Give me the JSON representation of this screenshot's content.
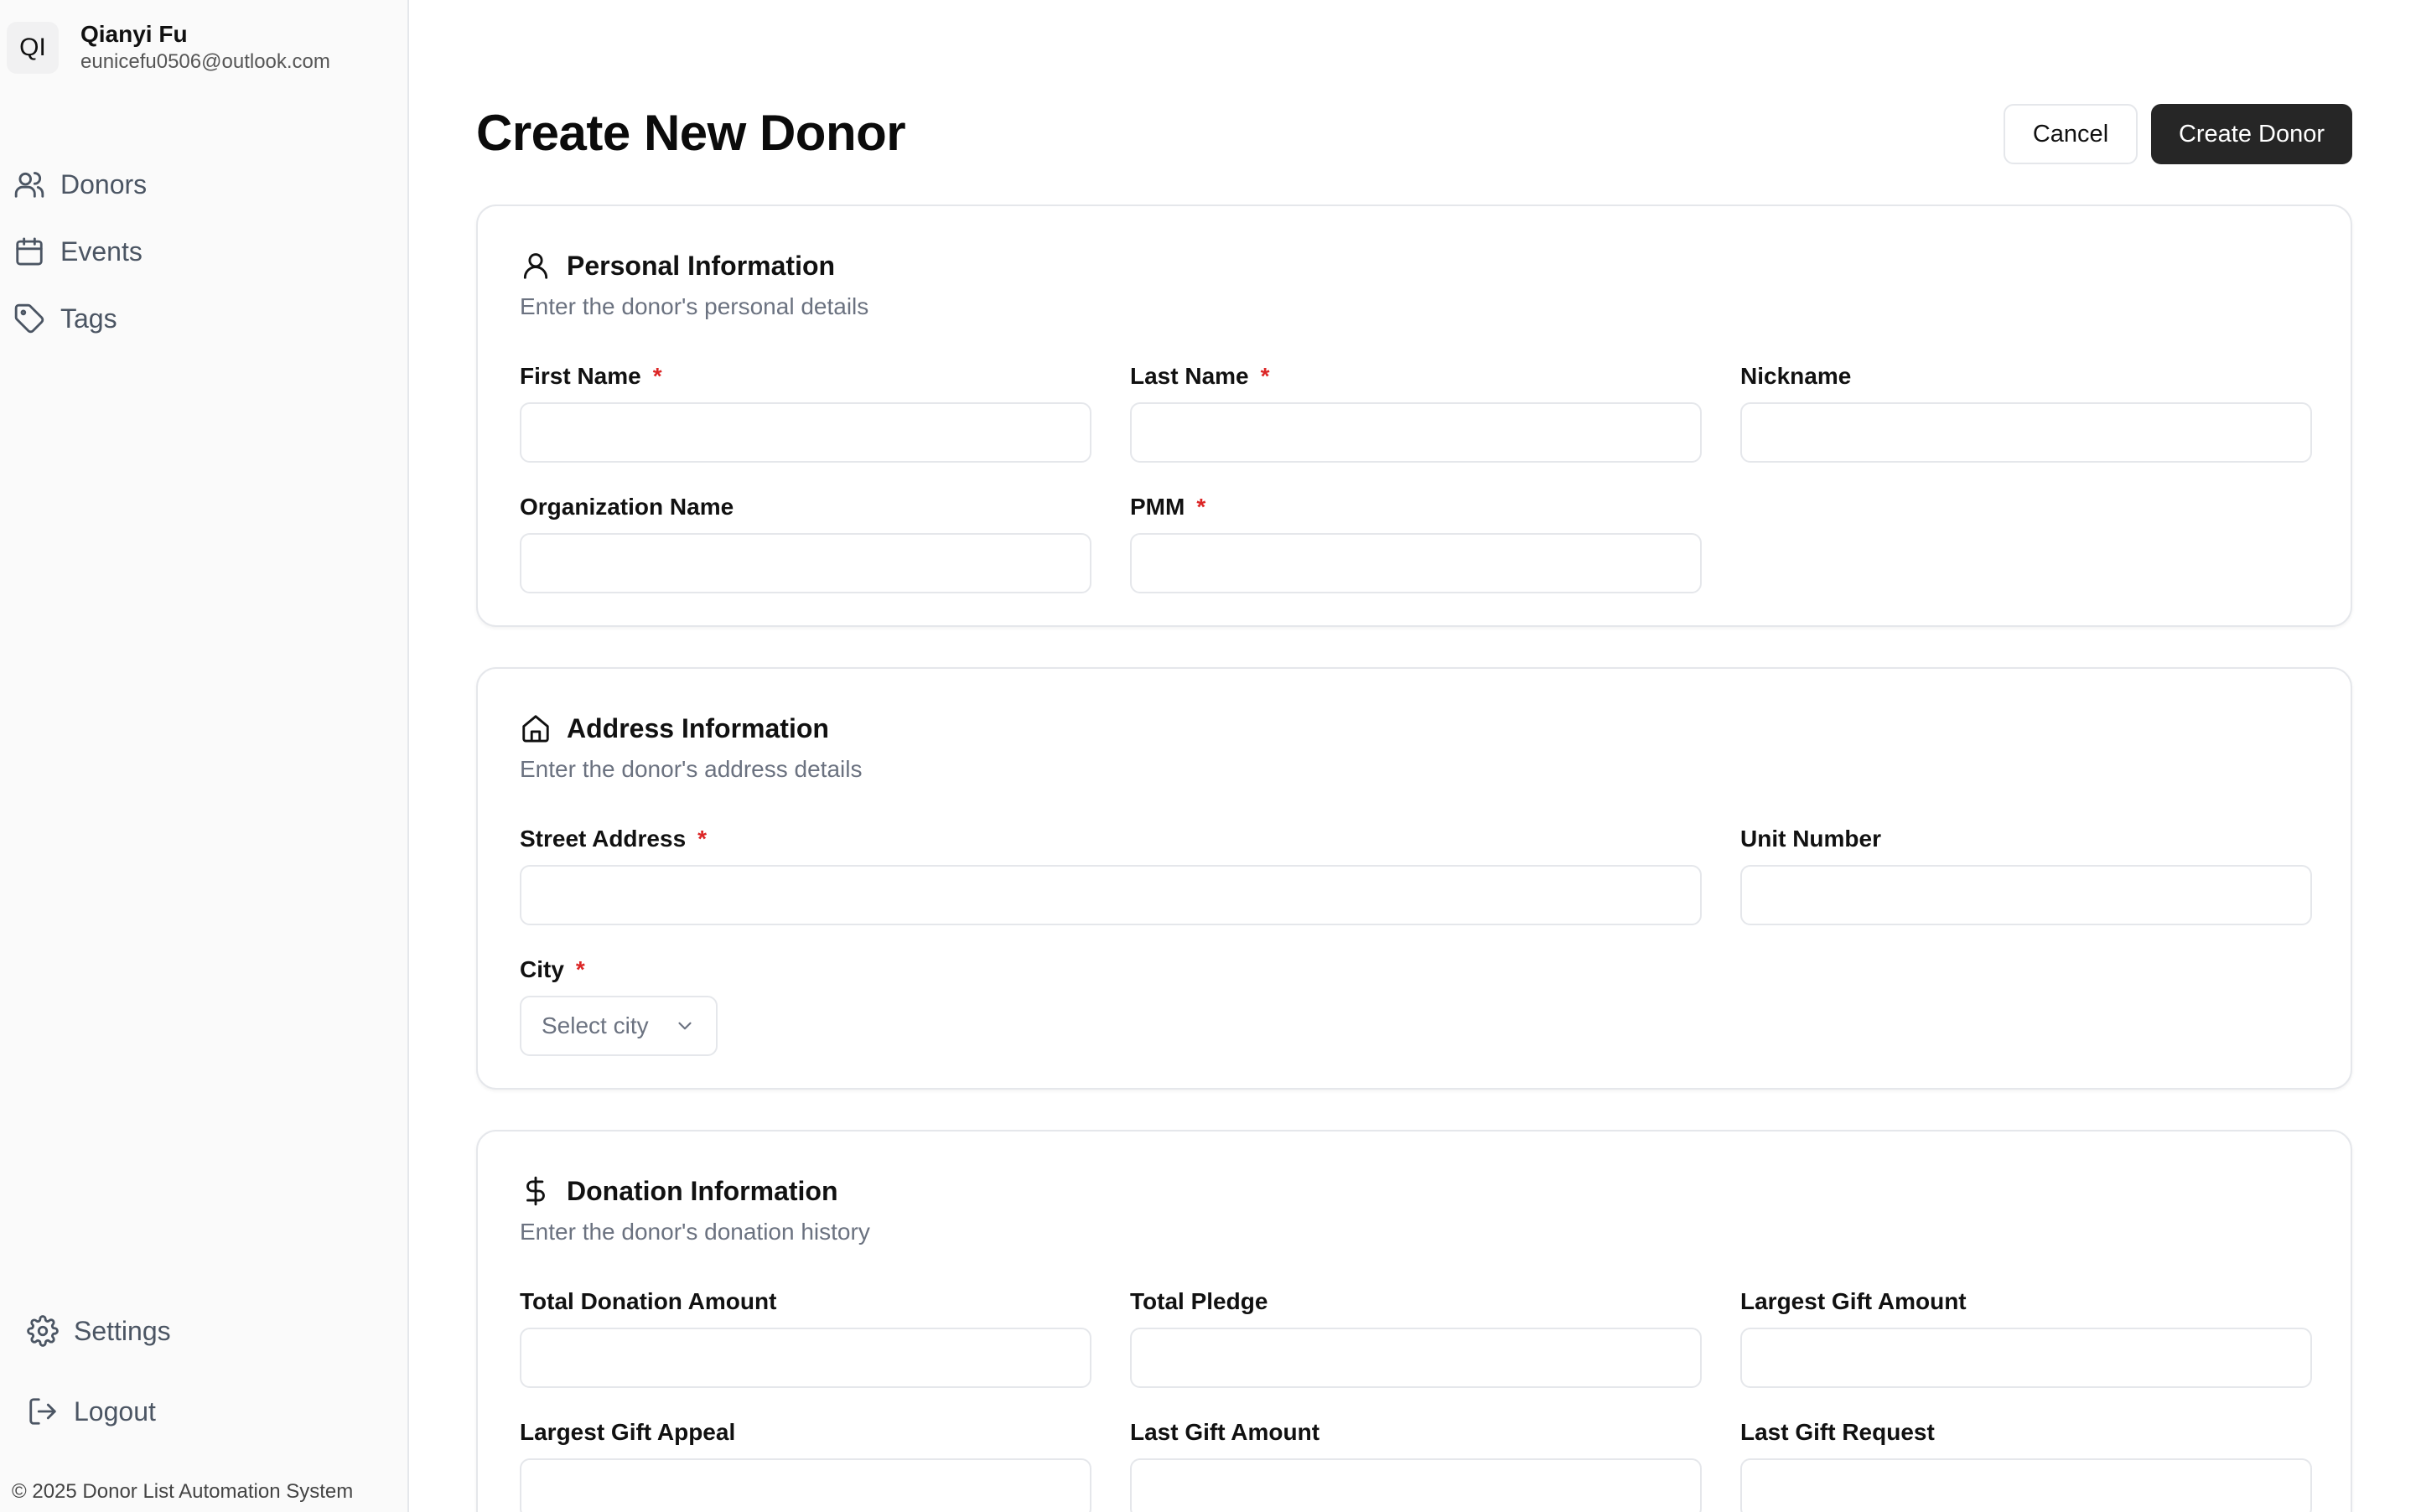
{
  "user": {
    "initials": "QI",
    "name": "Qianyi Fu",
    "email": "eunicefu0506@outlook.com"
  },
  "nav": {
    "donors": "Donors",
    "events": "Events",
    "tags": "Tags",
    "settings": "Settings",
    "logout": "Logout"
  },
  "footer": {
    "copyright": "© 2025 Donor List Automation System"
  },
  "header": {
    "title": "Create New Donor",
    "cancel": "Cancel",
    "create": "Create Donor"
  },
  "personal": {
    "title": "Personal Information",
    "desc": "Enter the donor's personal details",
    "first_name": "First Name",
    "last_name": "Last Name",
    "nickname": "Nickname",
    "organization": "Organization Name",
    "pmm": "PMM"
  },
  "address": {
    "title": "Address Information",
    "desc": "Enter the donor's address details",
    "street": "Street Address",
    "unit": "Unit Number",
    "city": "City",
    "city_placeholder": "Select city"
  },
  "donation": {
    "title": "Donation Information",
    "desc": "Enter the donor's donation history",
    "total_donation": "Total Donation Amount",
    "total_pledge": "Total Pledge",
    "largest_gift": "Largest Gift Amount",
    "largest_appeal": "Largest Gift Appeal",
    "last_gift": "Last Gift Amount",
    "last_request": "Last Gift Request"
  },
  "required_marker": "*"
}
